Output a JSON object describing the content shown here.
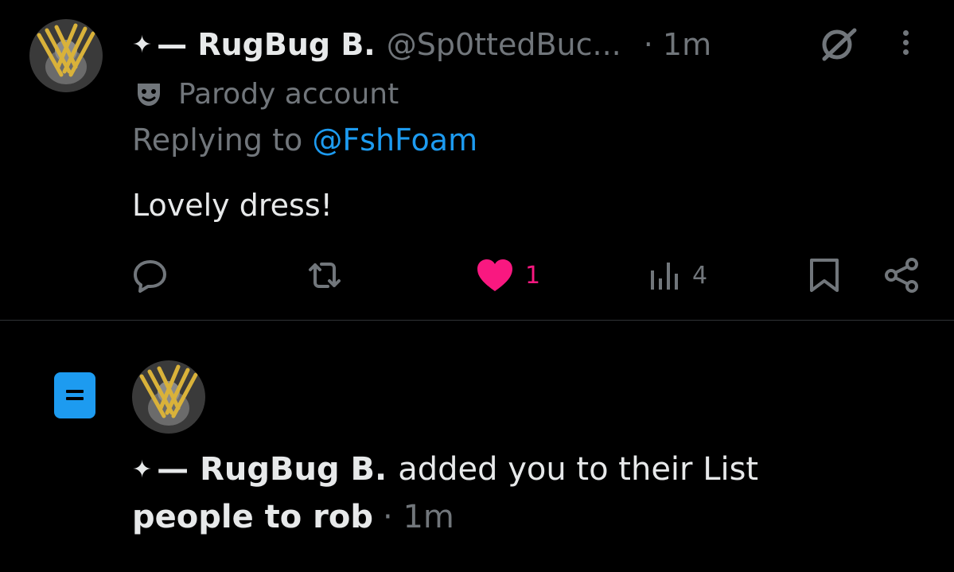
{
  "post": {
    "star": "✦",
    "display_name": "— RugBug B.",
    "handle": "@Sp0ttedBuc...",
    "time": "· 1m",
    "parody_label": "Parody account",
    "replying_prefix": "Replying to ",
    "replying_mention": "@FshFoam",
    "text": "Lovely dress!",
    "actions": {
      "reply_count": "",
      "repost_count": "",
      "like_count": "1",
      "views_count": "4"
    }
  },
  "notification": {
    "star": "✦",
    "actor_name": "— RugBug B.",
    "action_text": "added you to their List",
    "list_name": "people to rob",
    "time": "· 1m"
  },
  "colors": {
    "background": "#000000",
    "text": "#e7e9ea",
    "secondary": "#71767b",
    "link": "#1d9bf0",
    "like": "#f91880",
    "list_icon": "#1d9bf0",
    "divider": "#2f3336"
  },
  "icons": {
    "grok": "grok-icon",
    "more": "more-icon",
    "parody": "parody-mask-icon",
    "reply": "reply-icon",
    "repost": "repost-icon",
    "like": "heart-icon",
    "views": "views-icon",
    "bookmark": "bookmark-icon",
    "share": "share-icon",
    "list": "list-icon"
  }
}
